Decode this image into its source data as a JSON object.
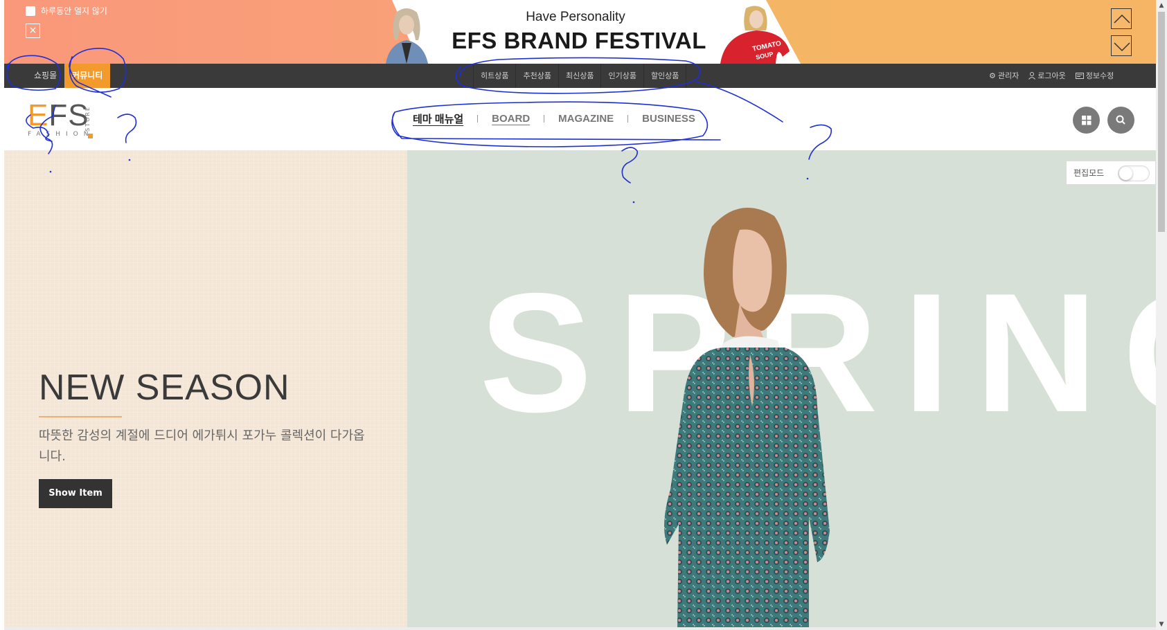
{
  "promo": {
    "dont_show_today": "하루동안 열지 않기",
    "close_label": "×",
    "subtitle": "Have Personality",
    "title": "EFS BRAND FESTIVAL",
    "shirt_text_1": "TOMATO",
    "shirt_text_2": "SOUP"
  },
  "topnav": {
    "left_tabs": [
      {
        "label": "쇼핑몰",
        "active": false
      },
      {
        "label": "커뮤니티",
        "active": true
      }
    ],
    "center_items": [
      "히트상품",
      "추천상품",
      "최신상품",
      "인기상품",
      "할인상품"
    ],
    "right_utils": [
      {
        "icon": "gear-icon",
        "label": "관리자"
      },
      {
        "icon": "user-icon",
        "label": "로그아웃"
      },
      {
        "icon": "card-icon",
        "label": "정보수정"
      }
    ]
  },
  "header": {
    "logo_text": "EFS",
    "logo_sub": "FASHION",
    "logo_store": "STORE",
    "menu": [
      "테마 매뉴얼",
      "BOARD",
      "MAGAZINE",
      "BUSINESS"
    ],
    "buttons": [
      "grid-icon",
      "search-icon"
    ]
  },
  "hero": {
    "bg_word": "SPRING",
    "title": "NEW SEASON",
    "description": "따뜻한 감성의 계절에 드디어 에가튀시 포가누 콜렉션이 다가옵니다.",
    "button_label": "Show Item"
  },
  "edit_mode": {
    "label": "편집모드",
    "enabled": false
  },
  "colors": {
    "accent": "#f29b2c",
    "nav_bg": "#3a3a3a",
    "hero_left": "#f3e6d6",
    "hero_right": "#d7e0d6",
    "annotation": "#1f2fd6"
  }
}
